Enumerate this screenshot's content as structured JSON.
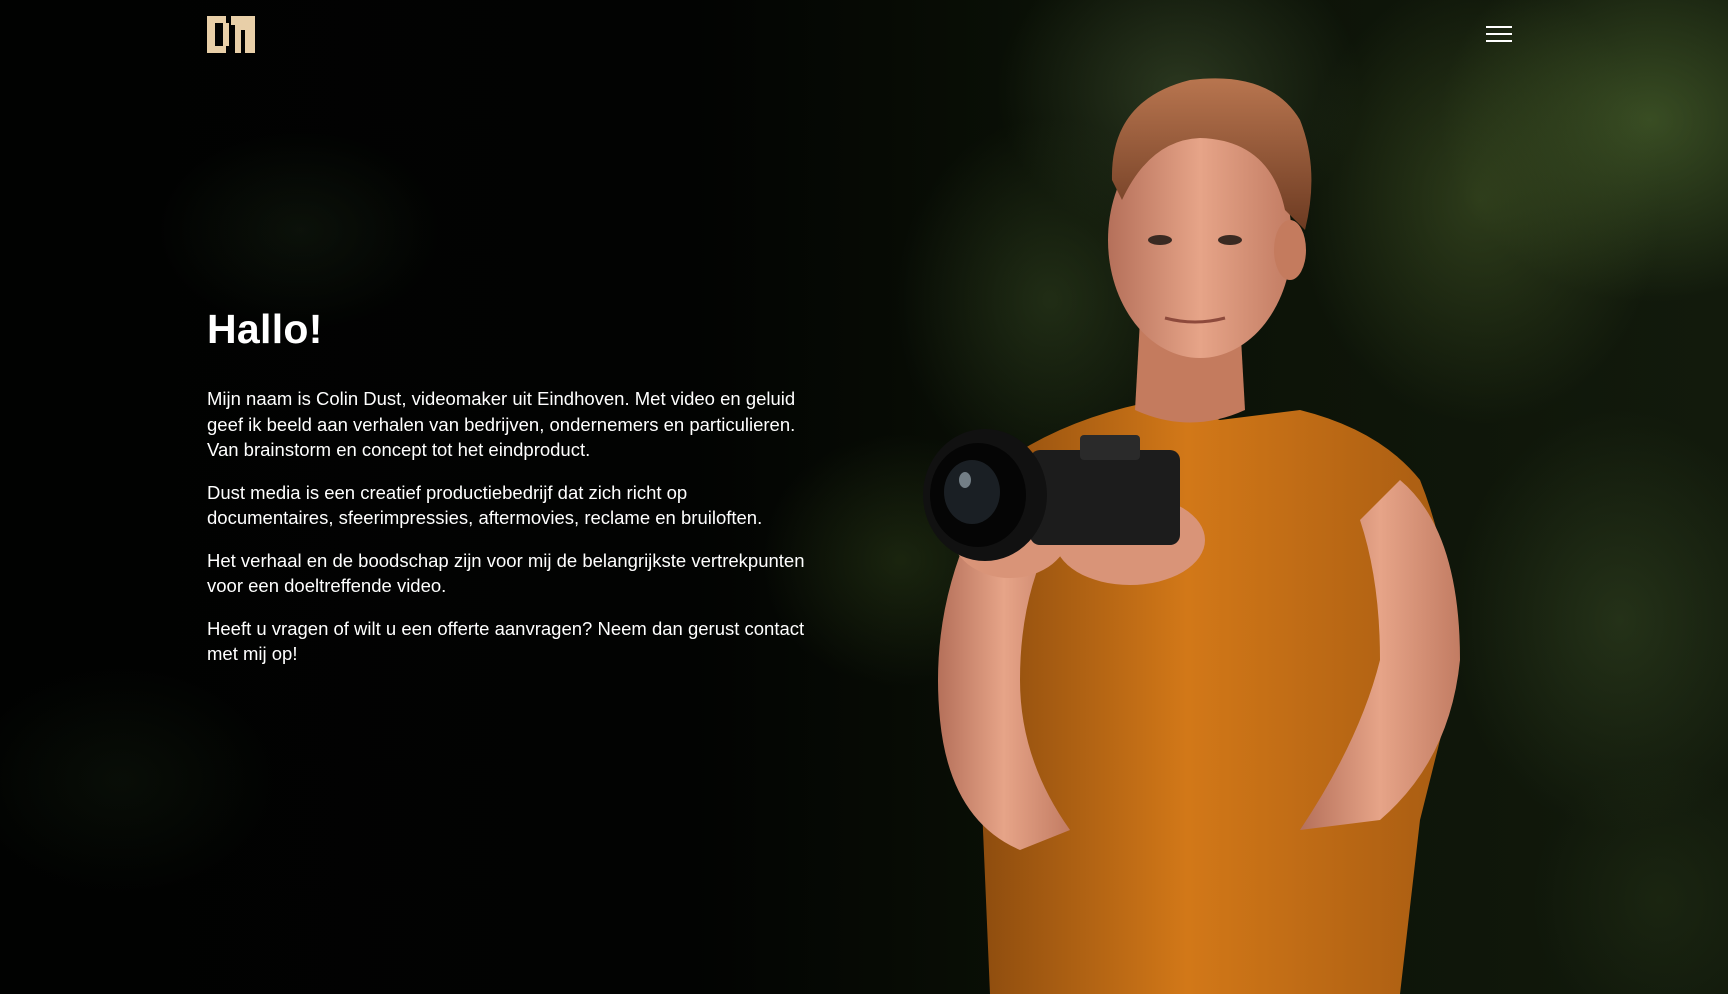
{
  "header": {
    "logo_alt": "DM",
    "menu_icon": "hamburger-menu-icon"
  },
  "hero": {
    "title": "Hallo!",
    "paragraphs": [
      "Mijn naam is Colin Dust, videomaker uit Eindhoven. Met video en geluid geef ik beeld aan verhalen van bedrijven, ondernemers en particulieren. Van brainstorm en concept tot het eindproduct.",
      "Dust media is een creatief productiebedrijf dat zich richt op documentaires, sfeerimpressies, aftermovies, reclame en bruiloften.",
      "Het verhaal en de boodschap zijn voor mij de belangrijkste vertrekpunten voor een doeltreffende video.",
      "Heeft u vragen of wilt u een offerte aanvragen? Neem dan gerust contact met mij op!"
    ]
  },
  "colors": {
    "background": "#020302",
    "text": "#ffffff",
    "logo": "#e8cfa8",
    "shirt": "#c46a14"
  }
}
